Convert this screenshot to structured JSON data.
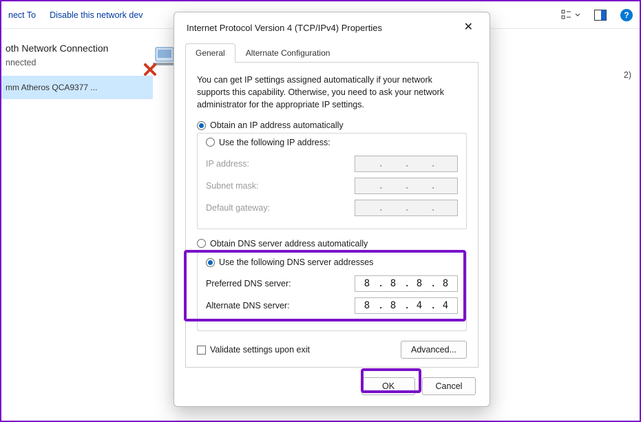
{
  "bg": {
    "toolbar": {
      "connect_to": "nect To",
      "disable": "Disable this network dev",
      "count_suffix": "2)"
    },
    "connection_title": "oth Network Connection",
    "connection_status": "nnected",
    "adapter_name": "mm Atheros QCA9377 ..."
  },
  "dialog": {
    "title": "Internet Protocol Version 4 (TCP/IPv4) Properties",
    "tabs": {
      "general": "General",
      "alt": "Alternate Configuration"
    },
    "desc": "You can get IP settings assigned automatically if your network supports this capability. Otherwise, you need to ask your network administrator for the appropriate IP settings.",
    "ip_auto": "Obtain an IP address automatically",
    "ip_manual": "Use the following IP address:",
    "ip_address_lbl": "IP address:",
    "subnet_lbl": "Subnet mask:",
    "gateway_lbl": "Default gateway:",
    "dns_auto": "Obtain DNS server address automatically",
    "dns_manual": "Use the following DNS server addresses",
    "pref_dns_lbl": "Preferred DNS server:",
    "alt_dns_lbl": "Alternate DNS server:",
    "pref_dns": {
      "a": "8",
      "b": "8",
      "c": "8",
      "d": "8"
    },
    "altd": {
      "a": "8",
      "b": "8",
      "c": "4",
      "d": "4"
    },
    "validate": "Validate settings upon exit",
    "advanced": "Advanced...",
    "ok": "OK",
    "cancel": "Cancel"
  }
}
